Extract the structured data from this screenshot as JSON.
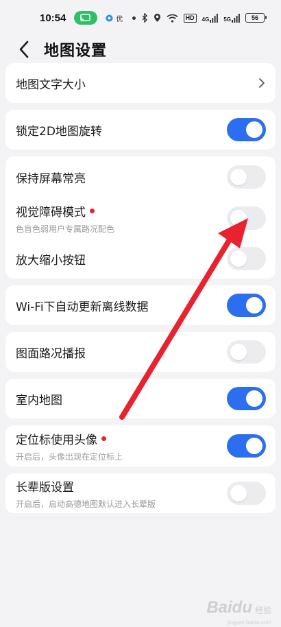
{
  "status_bar": {
    "time": "10:54",
    "small_label": "优",
    "battery": "56",
    "hd_label": "HD",
    "signal1_label": "4G",
    "signal2_label": "5G"
  },
  "header": {
    "title": "地图设置"
  },
  "settings": {
    "text_size": {
      "label": "地图文字大小"
    },
    "lock_rotation": {
      "label": "锁定2D地图旋转",
      "on": true
    },
    "keep_screen_on": {
      "label": "保持屏幕常亮",
      "on": false
    },
    "visual_mode": {
      "label": "视觉障碍模式",
      "sub": "色盲色弱用户专属路况配色",
      "on": false
    },
    "zoom_buttons": {
      "label": "放大缩小按钮",
      "on": false
    },
    "wifi_update": {
      "label": "Wi-Fi下自动更新离线数据",
      "on": true
    },
    "traffic_broadcast": {
      "label": "图面路况播报",
      "on": false
    },
    "indoor_map": {
      "label": "室内地图",
      "on": true
    },
    "avatar_locator": {
      "label": "定位标使用头像",
      "sub": "开启后，头像出现在定位标上",
      "on": true
    },
    "elder_mode": {
      "label": "长辈版设置",
      "sub": "开启后，启动高德地图默认进入长辈版",
      "on": false
    }
  },
  "colors": {
    "accent": "#2b6ff0",
    "red_dot": "#e5262a",
    "annotation_arrow": "#e8222e"
  },
  "watermark": {
    "main": "Baidu",
    "sub": "经验",
    "url": "jingyan.baidu.com"
  }
}
